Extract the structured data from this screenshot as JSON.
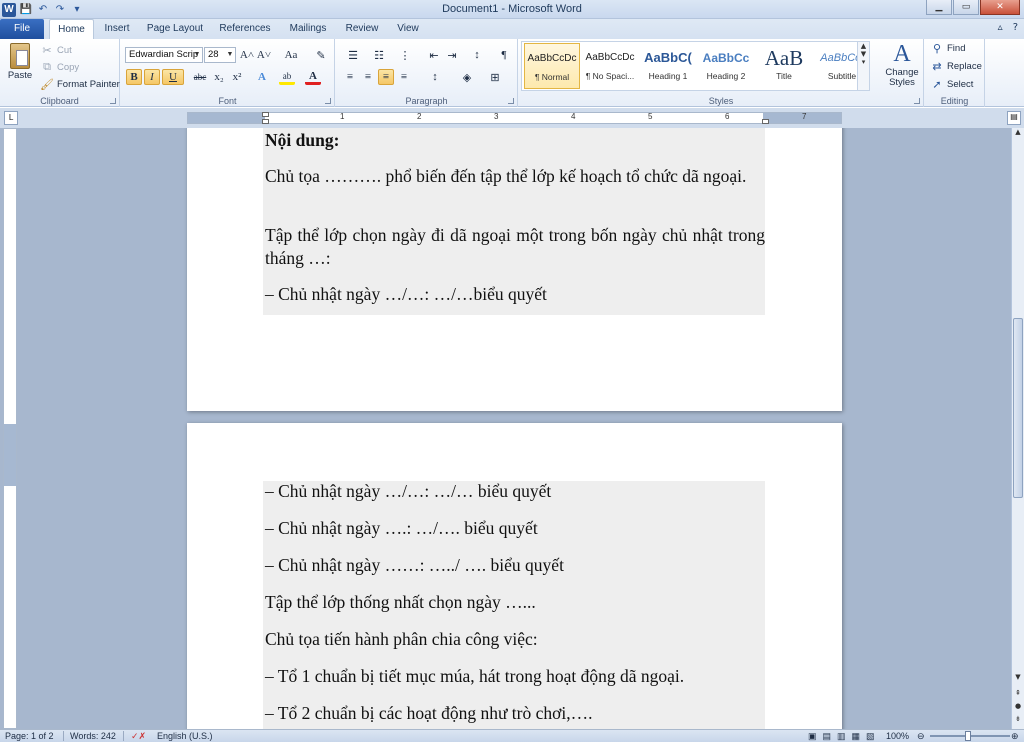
{
  "window": {
    "title": "Document1 - Microsoft Word",
    "qat": {
      "app_icon": "W",
      "save_icon": "💾",
      "undo_icon": "↶",
      "redo_icon": "↷",
      "customize_icon": "▾"
    },
    "controls": {
      "minimize": "▁",
      "maximize": "▭",
      "close": "✕"
    }
  },
  "tabs": [
    {
      "label": "File"
    },
    {
      "label": "Home"
    },
    {
      "label": "Insert"
    },
    {
      "label": "Page Layout"
    },
    {
      "label": "References"
    },
    {
      "label": "Mailings"
    },
    {
      "label": "Review"
    },
    {
      "label": "View"
    }
  ],
  "tab_right": {
    "minimize_ribbon": "▵",
    "help": "?"
  },
  "ribbon": {
    "clipboard": {
      "label": "Clipboard",
      "paste": "Paste",
      "cut": "Cut",
      "copy": "Copy",
      "format_painter": "Format Painter"
    },
    "font": {
      "label": "Font",
      "font_name": "Edwardian Scrip",
      "font_size": "28",
      "grow": "A˄",
      "shrink": "A˅",
      "change_case": "Aa",
      "clear_format": "✎",
      "bold": "B",
      "italic": "I",
      "underline": "U",
      "strike": "abc",
      "subscript": "x₂",
      "superscript": "x²",
      "text_effects": "A",
      "highlight": "ab",
      "font_color": "A"
    },
    "paragraph": {
      "label": "Paragraph",
      "bullets": "☰",
      "numbering": "☷",
      "multilevel": "⋮",
      "decrease_indent": "⇤",
      "increase_indent": "⇥",
      "sort": "↕",
      "show_marks": "¶",
      "align_left": "≡",
      "center": "≡",
      "align_right": "≡",
      "justify": "≡",
      "line_spacing": "↕",
      "shading": "◈",
      "borders": "⊞"
    },
    "styles": {
      "label": "Styles",
      "items": [
        {
          "sample": "AaBbCcDc",
          "name": "¶ Normal"
        },
        {
          "sample": "AaBbCcDc",
          "name": "¶ No Spaci..."
        },
        {
          "sample": "AaBbC(",
          "name": "Heading 1"
        },
        {
          "sample": "AaBbCc",
          "name": "Heading 2"
        },
        {
          "sample": "AaB",
          "name": "Title"
        },
        {
          "sample": "AaBbCc.",
          "name": "Subtitle"
        }
      ],
      "change_styles": "Change Styles"
    },
    "editing": {
      "label": "Editing",
      "find": "Find",
      "replace": "Replace",
      "select": "Select"
    }
  },
  "ruler": {
    "numbers": [
      "1",
      "2",
      "3",
      "4",
      "5",
      "6",
      "7"
    ],
    "tab_selector": "L"
  },
  "document": {
    "page1": [
      "Nội dung:",
      "Chủ tọa ………. phổ biến đến tập thể lớp kế hoạch tổ chức dã ngoại.",
      "Tập thể lớp chọn ngày đi dã ngoại một trong bốn ngày chủ nhật trong tháng …:",
      "– Chủ nhật ngày …/…: …/…biểu quyết"
    ],
    "page2": [
      "– Chủ nhật ngày …/…: …/… biểu quyết",
      "– Chủ nhật ngày ….: …/…. biểu quyết",
      "– Chủ nhật ngày ……: …../ …. biểu quyết",
      "Tập thể lớp thống nhất chọn ngày …...",
      "Chủ tọa tiến hành phân chia công việc:",
      "– Tổ 1 chuẩn bị tiết mục múa, hát trong hoạt động dã ngoại.",
      "– Tổ 2 chuẩn bị các hoạt động như trò chơi,…."
    ]
  },
  "status": {
    "page": "Page: 1 of 2",
    "words": "Words: 242",
    "language": "English (U.S.)",
    "zoom": "100%",
    "zoom_out": "⊖",
    "zoom_in": "⊕"
  },
  "colors": {
    "accent": "#2b579a",
    "ribbon_bg": "#e7eef8",
    "workspace": "#a7b7ce",
    "selected_style": "#fde9ad"
  }
}
